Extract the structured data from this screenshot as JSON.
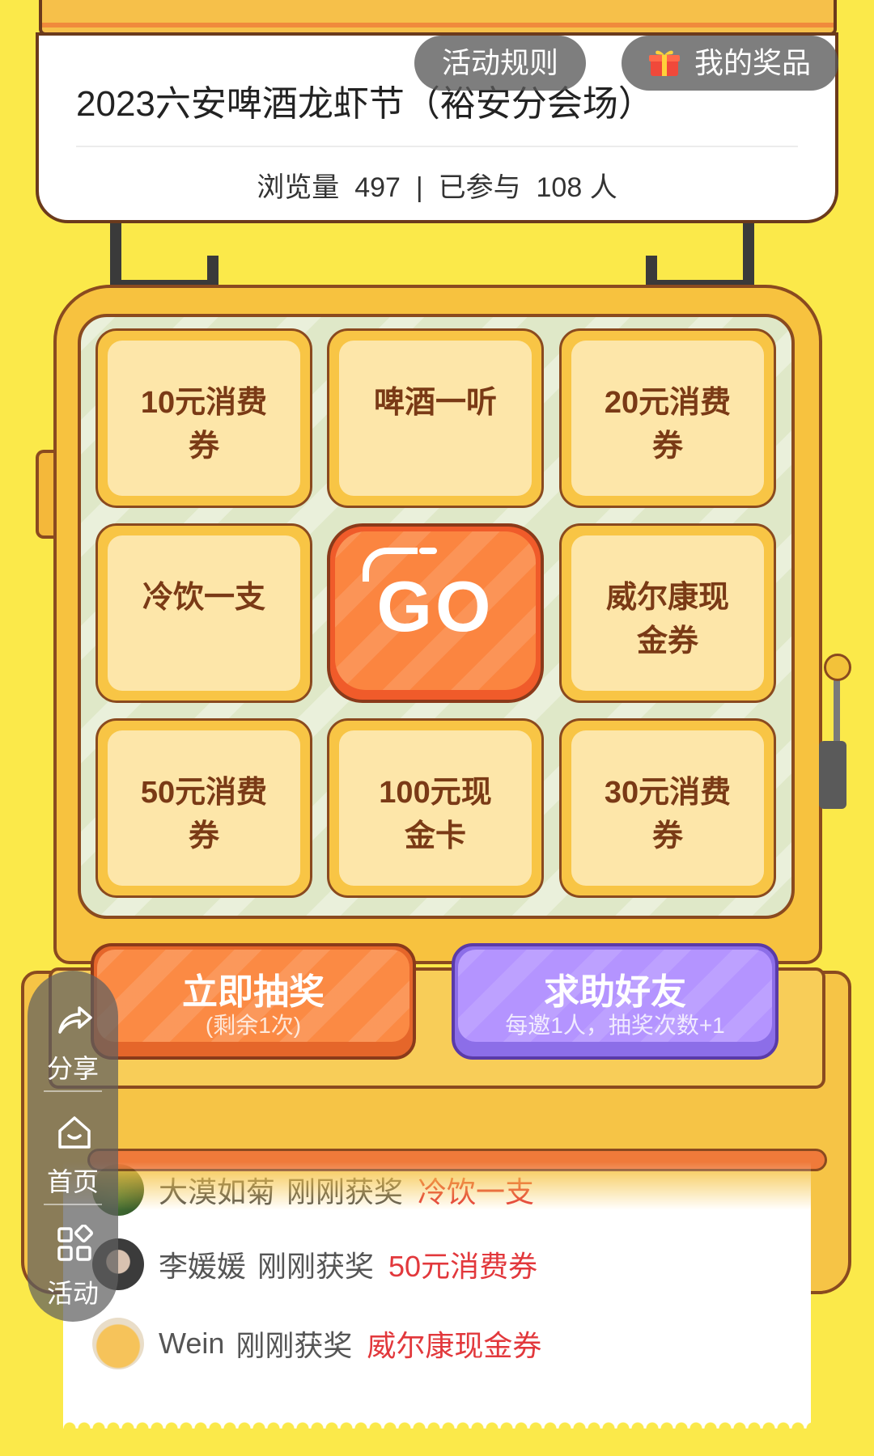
{
  "header": {
    "title": "2023六安啤酒龙虾节（裕安分会场）",
    "stats": {
      "views_label": "浏览量",
      "views": "497",
      "separator": "|",
      "participants_label": "已参与",
      "participants": "108",
      "participants_unit": "人"
    },
    "rules_button": "活动规则",
    "prizes_button": "我的奖品"
  },
  "prize_grid": {
    "cells": [
      {
        "label": "10元消费券"
      },
      {
        "label": "啤酒一听"
      },
      {
        "label": "20元消费券"
      },
      {
        "label": "冷饮一支"
      },
      {
        "label": "威尔康现金券"
      },
      {
        "label": "50元消费券"
      },
      {
        "label": "100元现金卡"
      },
      {
        "label": "30元消费券"
      }
    ],
    "go_label": "GO"
  },
  "actions": {
    "draw": {
      "label": "立即抽奖",
      "sub": "(剩余1次)"
    },
    "help": {
      "label": "求助好友",
      "sub": "每邀1人，抽奖次数+1"
    }
  },
  "winners": [
    {
      "name": "大漠如菊",
      "verb": "刚刚获奖",
      "prize": "冷饮一支"
    },
    {
      "name": "李媛媛",
      "verb": "刚刚获奖",
      "prize": "50元消费券"
    },
    {
      "name": "Wein",
      "verb": "刚刚获奖",
      "prize": "威尔康现金券"
    }
  ],
  "sidenav": {
    "items": [
      {
        "label": "分享",
        "icon": "share-icon"
      },
      {
        "label": "首页",
        "icon": "home-icon"
      },
      {
        "label": "活动",
        "icon": "grid-icon"
      }
    ]
  },
  "colors": {
    "background": "#fbe94a",
    "machine": "#f7c23f",
    "go_button": "#fb8540",
    "help_button": "#b494ff",
    "prize_text": "#e2383c"
  }
}
